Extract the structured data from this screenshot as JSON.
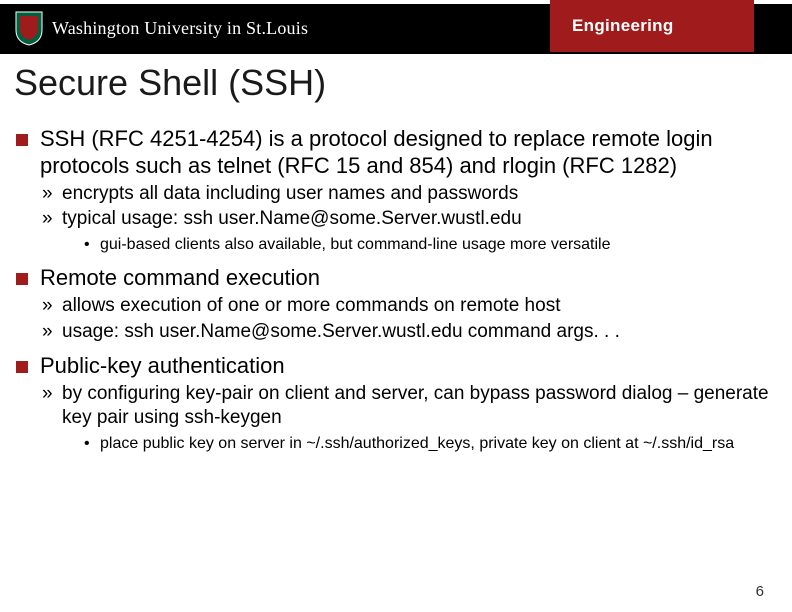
{
  "header": {
    "logo_main": "Washington University in St.Louis",
    "engineering": "Engineering"
  },
  "slide": {
    "title": "Secure Shell (SSH)",
    "b1": {
      "text": "SSH (RFC 4251-4254) is a protocol designed to replace remote login protocols such as telnet (RFC 15 and 854) and rlogin (RFC 1282)",
      "s1": "encrypts all data including user names and passwords",
      "s2": "typical usage: ssh user.Name@some.Server.wustl.edu",
      "s2a": "gui-based clients also available, but command-line usage more versatile"
    },
    "b2": {
      "text": "Remote command execution",
      "s1": "allows execution of one or more commands on remote host",
      "s2": "usage: ssh user.Name@some.Server.wustl.edu command args. . ."
    },
    "b3": {
      "text": "Public-key authentication",
      "s1": "by configuring key-pair on client and server, can bypass password dialog – generate key pair using ssh-keygen",
      "s1a": "place public key on server in ~/.ssh/authorized_keys, private key on client at ~/.ssh/id_rsa"
    },
    "page": "6"
  }
}
